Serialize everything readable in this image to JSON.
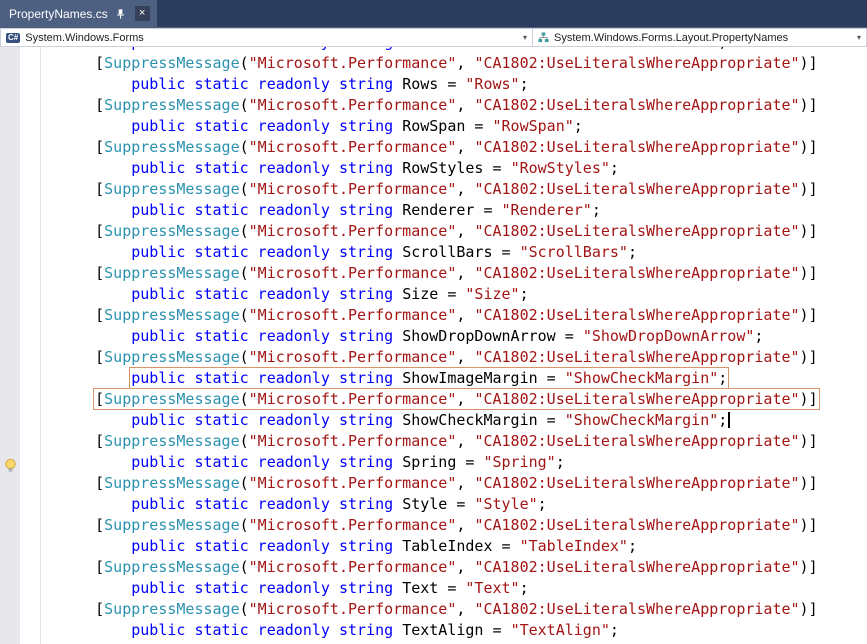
{
  "tab": {
    "title": "PropertyNames.cs",
    "close_glyph": "×"
  },
  "navbar": {
    "project": {
      "label": "System.Windows.Forms",
      "icon": "csharp-project-icon",
      "icon_text": "C#",
      "chevron": "▾"
    },
    "member": {
      "label": "System.Windows.Forms.Layout.PropertyNames",
      "icon": "class-icon",
      "chevron": "▾"
    }
  },
  "colors": {
    "tabstrip_bg": "#2C3C5F",
    "tab_bg": "#4D6082",
    "navbar_border": "#CCCEDB",
    "margin_bg": "#E8E8EC",
    "keyword": "#0000FF",
    "string": "#A31515",
    "attrname": "#2B91AF",
    "codetext": "#000000",
    "highlight_box": "#D8946A"
  },
  "code": {
    "indent_attr": "    ",
    "indent_decl": "        ",
    "decl_keywords": "public static readonly string",
    "assign": " = ",
    "semicolon": ";",
    "attr": {
      "open": "[",
      "name": "SuppressMessage",
      "lparen": "(",
      "arg1": "\"Microsoft.Performance\"",
      "sep": ", ",
      "arg2": "\"CA1802:UseLiteralsWhereAppropriate\"",
      "close": ")]"
    },
    "lines": [
      {
        "type": "decl",
        "name": "RowHeaderSwitch",
        "value": "RowHeaderSwitch",
        "clipped": true
      },
      {
        "type": "attr"
      },
      {
        "type": "decl",
        "name": "Rows",
        "value": "Rows"
      },
      {
        "type": "attr"
      },
      {
        "type": "decl",
        "name": "RowSpan",
        "value": "RowSpan"
      },
      {
        "type": "attr"
      },
      {
        "type": "decl",
        "name": "RowStyles",
        "value": "RowStyles"
      },
      {
        "type": "attr"
      },
      {
        "type": "decl",
        "name": "Renderer",
        "value": "Renderer"
      },
      {
        "type": "attr"
      },
      {
        "type": "decl",
        "name": "ScrollBars",
        "value": "ScrollBars"
      },
      {
        "type": "attr"
      },
      {
        "type": "decl",
        "name": "Size",
        "value": "Size"
      },
      {
        "type": "attr"
      },
      {
        "type": "decl",
        "name": "ShowDropDownArrow",
        "value": "ShowDropDownArrow"
      },
      {
        "type": "attr"
      },
      {
        "type": "decl",
        "name": "ShowImageMargin",
        "value": "ShowCheckMargin",
        "box": true
      },
      {
        "type": "attr",
        "box": true
      },
      {
        "type": "decl",
        "name": "ShowCheckMargin",
        "value": "ShowCheckMargin",
        "caret": true,
        "lightbulb": true
      },
      {
        "type": "attr"
      },
      {
        "type": "decl",
        "name": "Spring",
        "value": "Spring"
      },
      {
        "type": "attr"
      },
      {
        "type": "decl",
        "name": "Style",
        "value": "Style"
      },
      {
        "type": "attr"
      },
      {
        "type": "decl",
        "name": "TableIndex",
        "value": "TableIndex"
      },
      {
        "type": "attr"
      },
      {
        "type": "decl",
        "name": "Text",
        "value": "Text"
      },
      {
        "type": "attr"
      },
      {
        "type": "decl",
        "name": "TextAlign",
        "value": "TextAlign"
      }
    ]
  }
}
